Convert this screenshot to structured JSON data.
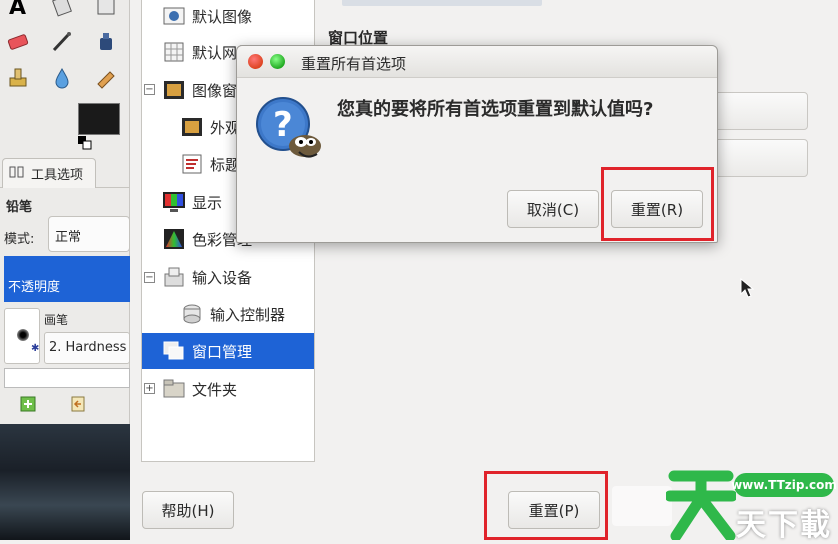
{
  "toolbox": {
    "tab_label": "工具选项",
    "tool_title": "铅笔",
    "mode_label": "模式:",
    "mode_value": "正常",
    "opacity_label": "不透明度",
    "brush_label": "画笔",
    "brush_value": "2. Hardness"
  },
  "prefs_tree": {
    "items": [
      {
        "label": "默认图像",
        "icon": "default-image-icon"
      },
      {
        "label": "默认网格",
        "icon": "default-grid-icon"
      },
      {
        "label": "图像窗口",
        "icon": "image-window-icon"
      },
      {
        "label": "外观",
        "icon": "appearance-icon"
      },
      {
        "label": "标题",
        "icon": "title-icon"
      },
      {
        "label": "显示",
        "icon": "display-icon"
      },
      {
        "label": "色彩管理",
        "icon": "color-management-icon"
      },
      {
        "label": "输入设备",
        "icon": "input-devices-icon"
      },
      {
        "label": "输入控制器",
        "icon": "input-controllers-icon"
      },
      {
        "label": "窗口管理",
        "icon": "window-management-icon"
      },
      {
        "label": "文件夹",
        "icon": "folders-icon"
      }
    ],
    "selected": "窗口管理"
  },
  "main": {
    "section_title": "窗口位置",
    "help_button": "帮助(H)",
    "reset_button": "重置(P)"
  },
  "dialog": {
    "title": "重置所有首选项",
    "question": "您真的要将所有首选项重置到默认值吗?",
    "cancel_label": "取消(C)",
    "reset_label": "重置(R)"
  },
  "watermark": {
    "url": "www.TTzip.com",
    "brand": "天下載"
  },
  "colors": {
    "selection": "#1e63d6",
    "highlight_box": "#e0232b",
    "watermark_green": "#2fb84a"
  }
}
